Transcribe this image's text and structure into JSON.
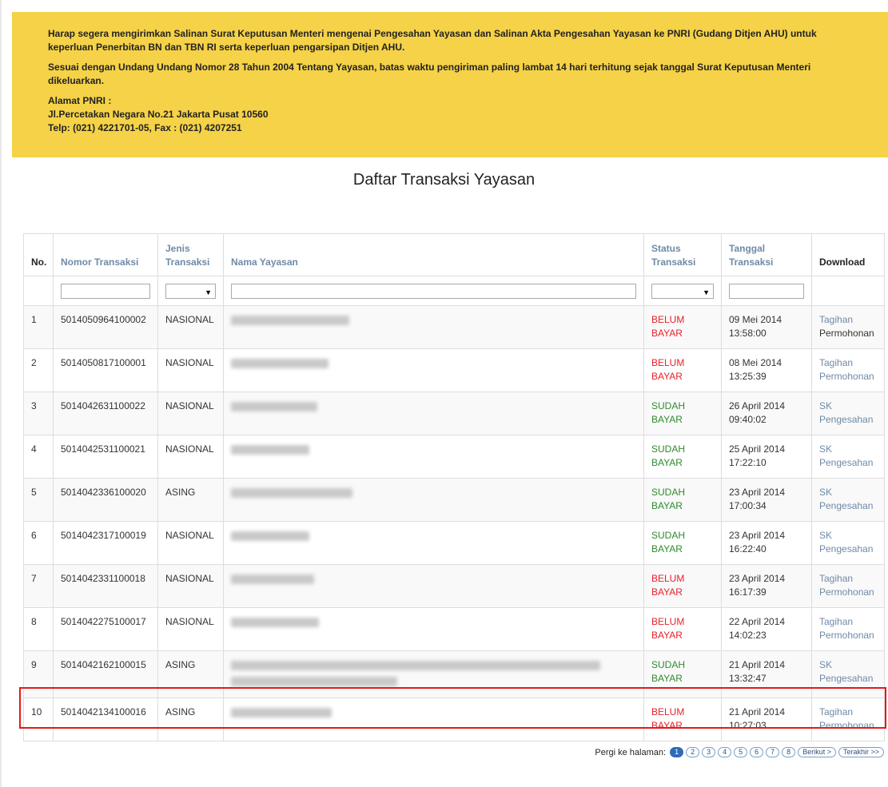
{
  "notice": {
    "para1": "Harap segera mengirimkan Salinan Surat Keputusan Menteri mengenai Pengesahan Yayasan dan Salinan Akta Pengesahan Yayasan ke PNRI (Gudang Ditjen AHU) untuk keperluan Penerbitan BN dan TBN RI serta keperluan pengarsipan Ditjen AHU.",
    "para2": "Sesuai dengan Undang Undang Nomor 28 Tahun 2004 Tentang Yayasan, batas waktu pengiriman paling lambat 14 hari terhitung sejak tanggal Surat Keputusan Menteri dikeluarkan.",
    "address_title": "Alamat PNRI :",
    "address_line1": "Jl.Percetakan Negara No.21 Jakarta Pusat 10560",
    "address_line2": "Telp: (021) 4221701-05, Fax : (021) 4207251"
  },
  "page_title": "Daftar Transaksi Yayasan",
  "table": {
    "headers": {
      "no": "No.",
      "nomor": "Nomor Transaksi",
      "jenis_line1": "Jenis",
      "jenis_line2": "Transaksi",
      "nama": "Nama Yayasan",
      "status_line1": "Status",
      "status_line2": "Transaksi",
      "tanggal_line1": "Tanggal",
      "tanggal_line2": "Transaksi",
      "download": "Download"
    },
    "select_arrow": "▼",
    "rows": [
      {
        "no": "1",
        "nomor": "5014050964100002",
        "jenis": "NASIONAL",
        "status1": "BELUM",
        "status2": "BAYAR",
        "status_color": "red",
        "tgl1": "09 Mei 2014",
        "tgl2": "13:58:00",
        "dl1": "Tagihan",
        "dl2": "Permohonan",
        "dl1_link": true,
        "dl2_link": false,
        "blur_w": 148,
        "blur_lines": 1
      },
      {
        "no": "2",
        "nomor": "5014050817100001",
        "jenis": "NASIONAL",
        "status1": "BELUM",
        "status2": "BAYAR",
        "status_color": "red",
        "tgl1": "08 Mei 2014",
        "tgl2": "13:25:39",
        "dl1": "Tagihan",
        "dl2": "Permohonan",
        "dl1_link": true,
        "dl2_link": true,
        "blur_w": 122,
        "blur_lines": 1
      },
      {
        "no": "3",
        "nomor": "5014042631100022",
        "jenis": "NASIONAL",
        "status1": "SUDAH",
        "status2": "BAYAR",
        "status_color": "green",
        "tgl1": "26 April 2014",
        "tgl2": "09:40:02",
        "dl1": "SK",
        "dl2": "Pengesahan",
        "dl1_link": true,
        "dl2_link": true,
        "blur_w": 108,
        "blur_lines": 1
      },
      {
        "no": "4",
        "nomor": "5014042531100021",
        "jenis": "NASIONAL",
        "status1": "SUDAH",
        "status2": "BAYAR",
        "status_color": "green",
        "tgl1": "25 April 2014",
        "tgl2": "17:22:10",
        "dl1": "SK",
        "dl2": "Pengesahan",
        "dl1_link": true,
        "dl2_link": true,
        "blur_w": 98,
        "blur_lines": 1
      },
      {
        "no": "5",
        "nomor": "5014042336100020",
        "jenis": "ASING",
        "status1": "SUDAH",
        "status2": "BAYAR",
        "status_color": "green",
        "tgl1": "23 April 2014",
        "tgl2": "17:00:34",
        "dl1": "SK",
        "dl2": "Pengesahan",
        "dl1_link": true,
        "dl2_link": true,
        "blur_w": 152,
        "blur_lines": 1
      },
      {
        "no": "6",
        "nomor": "5014042317100019",
        "jenis": "NASIONAL",
        "status1": "SUDAH",
        "status2": "BAYAR",
        "status_color": "green",
        "tgl1": "23 April 2014",
        "tgl2": "16:22:40",
        "dl1": "SK",
        "dl2": "Pengesahan",
        "dl1_link": true,
        "dl2_link": true,
        "blur_w": 98,
        "blur_lines": 1
      },
      {
        "no": "7",
        "nomor": "5014042331100018",
        "jenis": "NASIONAL",
        "status1": "BELUM",
        "status2": "BAYAR",
        "status_color": "red",
        "tgl1": "23 April 2014",
        "tgl2": "16:17:39",
        "dl1": "Tagihan",
        "dl2": "Permohonan",
        "dl1_link": true,
        "dl2_link": true,
        "blur_w": 104,
        "blur_lines": 1
      },
      {
        "no": "8",
        "nomor": "5014042275100017",
        "jenis": "NASIONAL",
        "status1": "BELUM",
        "status2": "BAYAR",
        "status_color": "red",
        "tgl1": "22 April 2014",
        "tgl2": "14:02:23",
        "dl1": "Tagihan",
        "dl2": "Permohonan",
        "dl1_link": true,
        "dl2_link": true,
        "blur_w": 110,
        "blur_lines": 1
      },
      {
        "no": "9",
        "nomor": "5014042162100015",
        "jenis": "ASING",
        "status1": "SUDAH",
        "status2": "BAYAR",
        "status_color": "green",
        "tgl1": "21 April 2014",
        "tgl2": "13:32:47",
        "dl1": "SK",
        "dl2": "Pengesahan",
        "dl1_link": true,
        "dl2_link": true,
        "blur_w": 462,
        "blur_lines": 2
      },
      {
        "no": "10",
        "nomor": "5014042134100016",
        "jenis": "ASING",
        "status1": "BELUM",
        "status2": "BAYAR",
        "status_color": "red",
        "tgl1": "21 April 2014",
        "tgl2": "10:27:03",
        "dl1": "Tagihan",
        "dl2": "Permohonan",
        "dl1_link": true,
        "dl2_link": true,
        "blur_w": 126,
        "blur_lines": 1
      }
    ]
  },
  "pager": {
    "label": "Pergi ke halaman:",
    "pages": [
      "1",
      "2",
      "3",
      "4",
      "5",
      "6",
      "7",
      "8"
    ],
    "active": "1",
    "next": "Berikut >",
    "last": "Terakhir >>"
  },
  "colors": {
    "notice_bg": "#f5d247",
    "link": "#6f8aa6",
    "status_red": "#e8202a",
    "status_green": "#2e8b2e",
    "highlight": "#e21a1a"
  }
}
